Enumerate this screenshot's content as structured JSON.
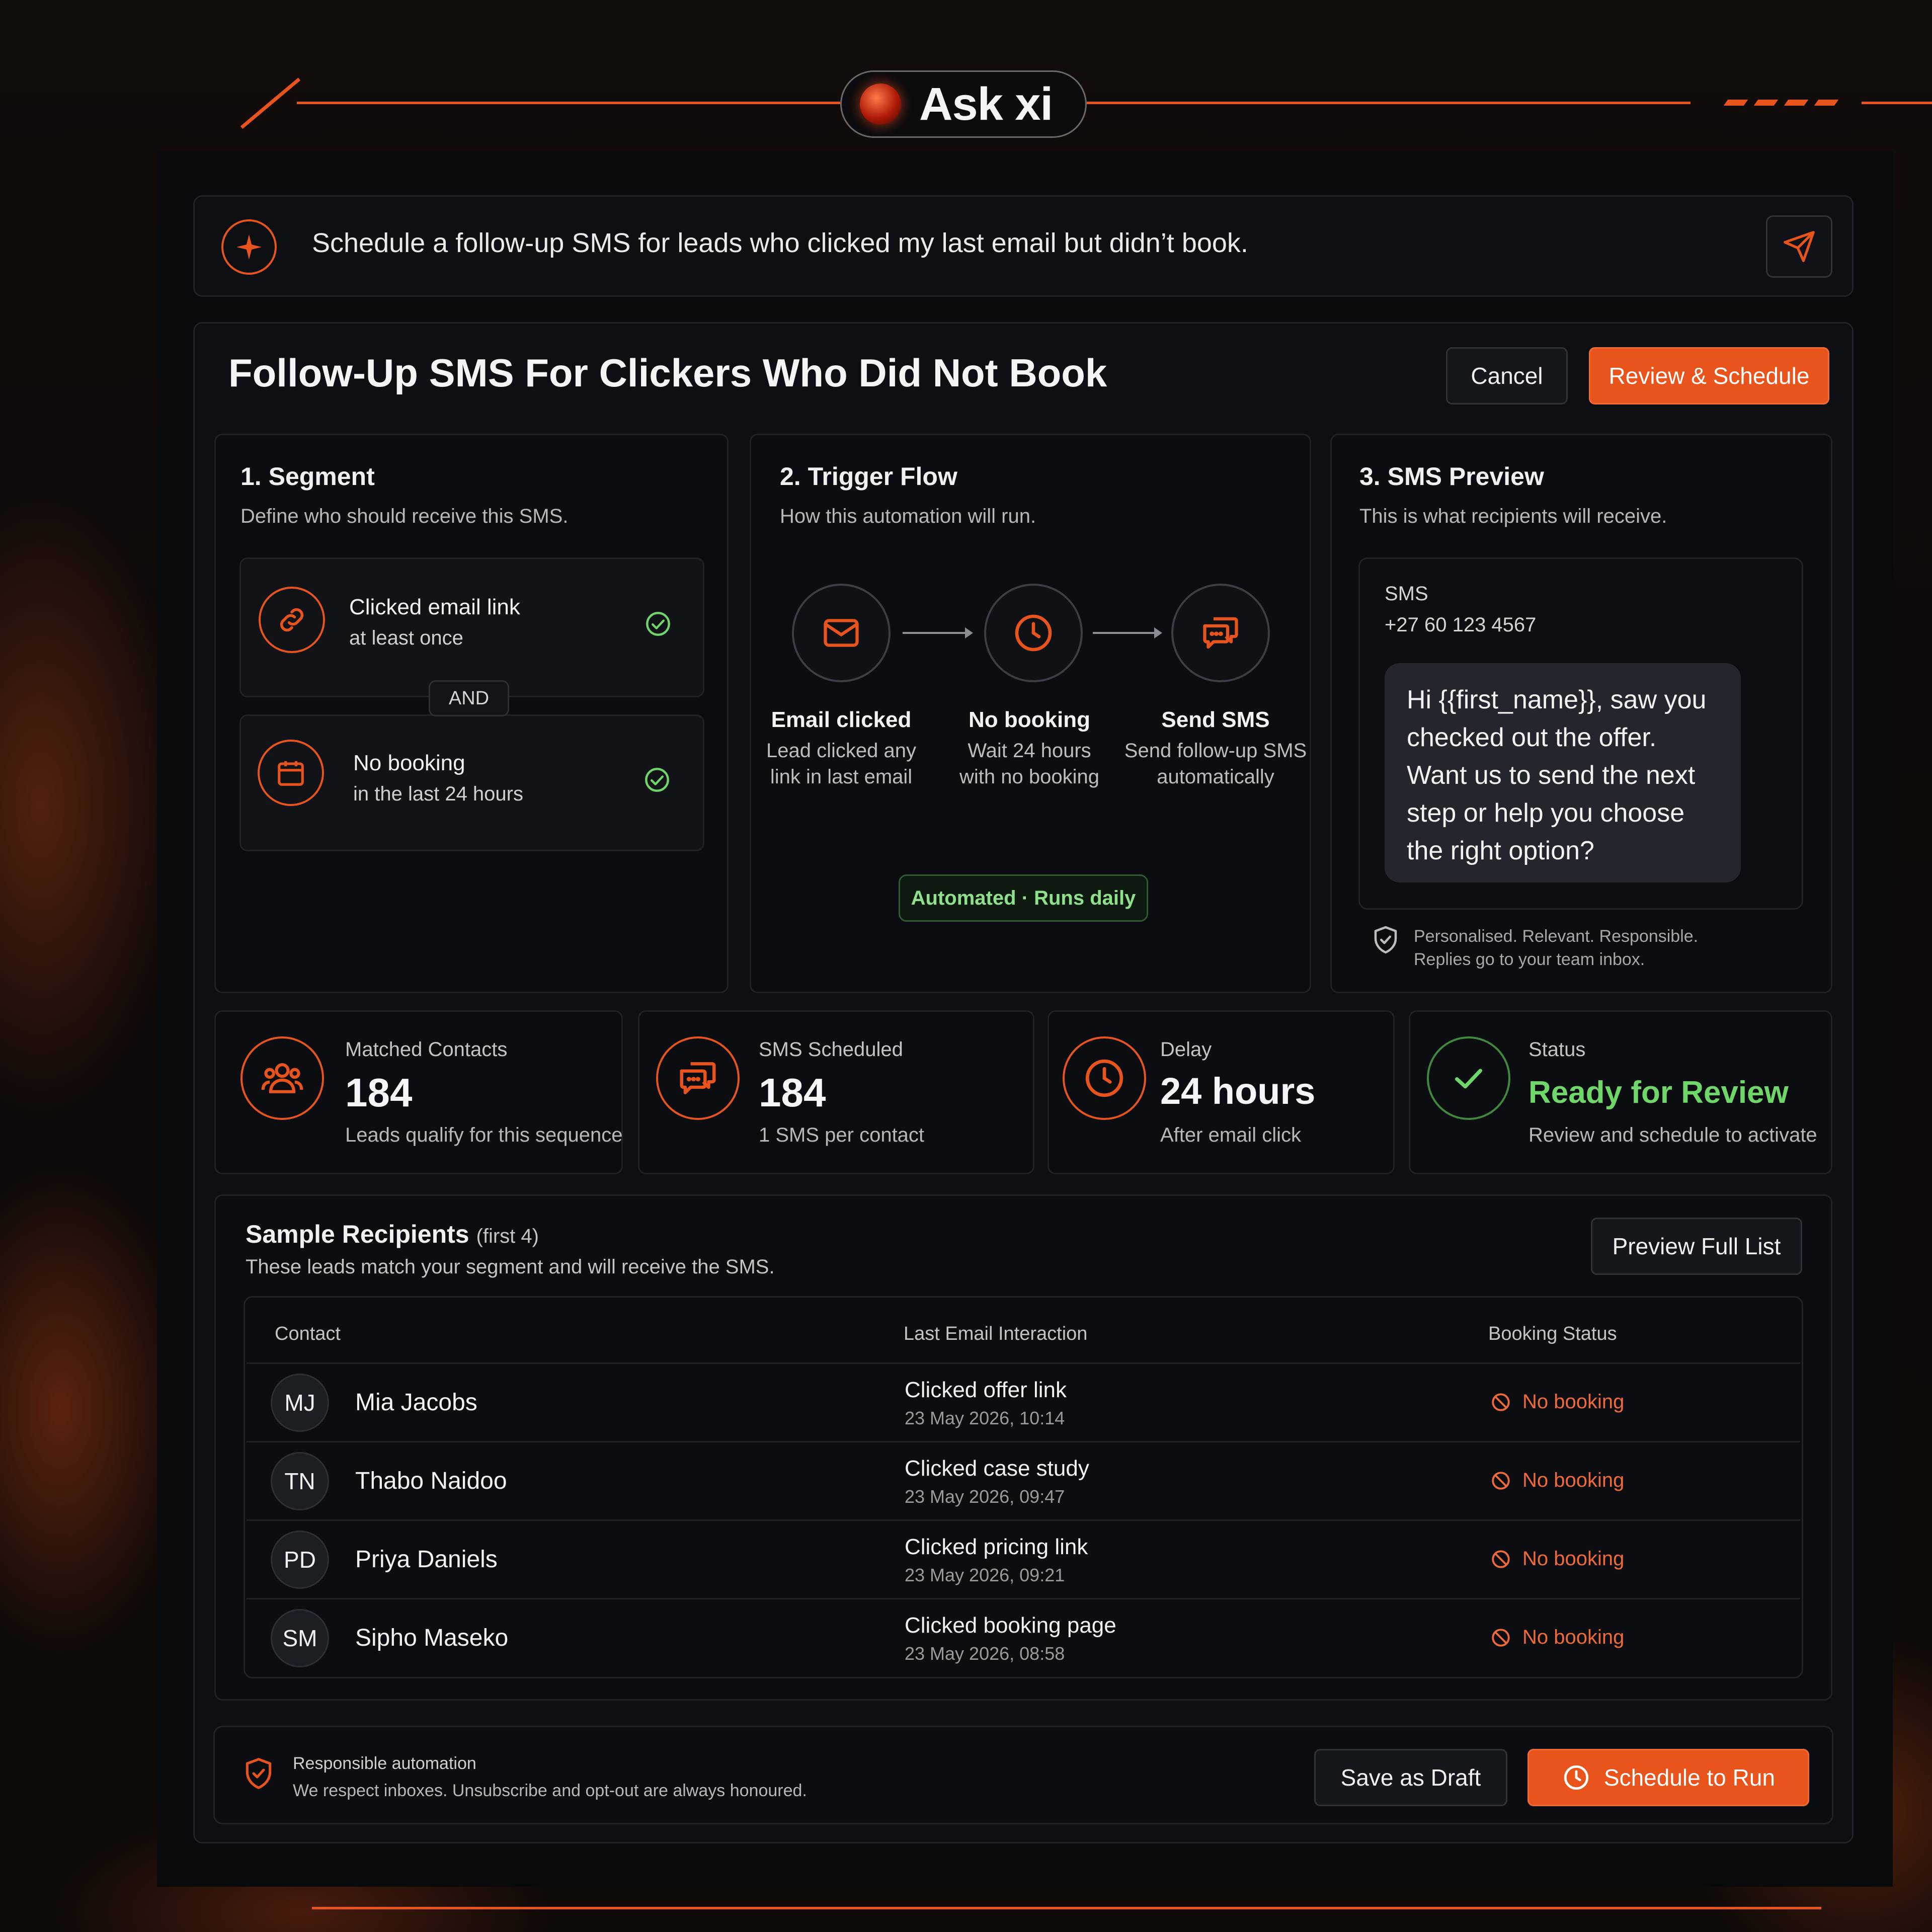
{
  "logo": {
    "text": "Ask xi"
  },
  "ask_bar": {
    "prompt": "Schedule a follow-up SMS for leads who clicked my last email but didn’t book."
  },
  "header": {
    "title": "Follow-Up SMS For Clickers Who Did Not Book",
    "cancel_label": "Cancel",
    "review_label": "Review & Schedule"
  },
  "segment": {
    "title": "1. Segment",
    "subtitle": "Define who should receive this SMS.",
    "conditions": [
      {
        "line1": "Clicked email link",
        "line2": "at least once",
        "icon": "link-icon"
      },
      {
        "line1": "No booking",
        "line2": "in the last 24 hours",
        "icon": "calendar-icon"
      }
    ],
    "joiner": "AND"
  },
  "trigger": {
    "title": "2. Trigger Flow",
    "subtitle": "How this automation will run.",
    "steps": [
      {
        "title": "Email clicked",
        "line1": "Lead clicked any",
        "line2": "link in last email",
        "icon": "mail-icon"
      },
      {
        "title": "No booking",
        "line1": "Wait 24 hours",
        "line2": "with no booking",
        "icon": "clock-icon"
      },
      {
        "title": "Send SMS",
        "line1": "Send follow-up SMS",
        "line2": "automatically",
        "icon": "chat-icon"
      }
    ],
    "badge": "Automated · Runs daily"
  },
  "preview": {
    "title": "3. SMS Preview",
    "subtitle": "This is what recipients will receive.",
    "channel": "SMS",
    "phone": "+27 60 123 4567",
    "message": "Hi {{first_name}}, saw you checked out the offer. Want us to send the next step or help you choose the right option?",
    "note1": "Personalised. Relevant. Responsible.",
    "note2": "Replies go to your team inbox."
  },
  "stats": [
    {
      "label": "Matched Contacts",
      "value": "184",
      "note": "Leads qualify for this sequence",
      "icon": "users-icon"
    },
    {
      "label": "SMS Scheduled",
      "value": "184",
      "note": "1 SMS per contact",
      "icon": "chat-icon"
    },
    {
      "label": "Delay",
      "value": "24 hours",
      "note": "After email click",
      "icon": "clock-icon"
    },
    {
      "label": "Status",
      "value": "Ready for Review",
      "note": "Review and schedule to activate",
      "icon": "check-icon"
    }
  ],
  "recipients": {
    "title": "Sample Recipients",
    "count_note": "(first 4)",
    "subtitle": "These leads match your segment and will receive the SMS.",
    "preview_label": "Preview Full List",
    "columns": [
      "Contact",
      "Last Email Interaction",
      "Booking Status"
    ],
    "rows": [
      {
        "initials": "MJ",
        "name": "Mia Jacobs",
        "action": "Clicked offer link",
        "date": "23 May 2026, 10:14",
        "status": "No booking"
      },
      {
        "initials": "TN",
        "name": "Thabo Naidoo",
        "action": "Clicked case study",
        "date": "23 May 2026, 09:47",
        "status": "No booking"
      },
      {
        "initials": "PD",
        "name": "Priya Daniels",
        "action": "Clicked pricing link",
        "date": "23 May 2026, 09:21",
        "status": "No booking"
      },
      {
        "initials": "SM",
        "name": "Sipho Maseko",
        "action": "Clicked booking page",
        "date": "23 May 2026, 08:58",
        "status": "No booking"
      }
    ]
  },
  "footer": {
    "title": "Responsible automation",
    "text": "We respect inboxes. Unsubscribe and opt-out are always honoured.",
    "draft_label": "Save as Draft",
    "schedule_label": "Schedule to Run"
  },
  "colors": {
    "accent": "#e8541c",
    "success": "#6fd66a",
    "background": "#090a0c"
  }
}
